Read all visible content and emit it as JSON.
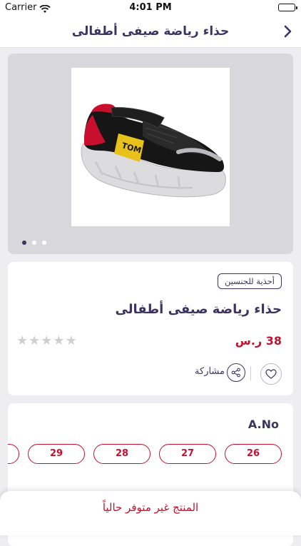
{
  "status_bar": {
    "carrier": "Carrier",
    "time": "4:01 PM"
  },
  "nav": {
    "title": "حذاء رياضة صيفى أطفالى"
  },
  "gallery": {
    "image_count": 3,
    "active_index": 0,
    "shoe_brand": "TOM"
  },
  "product": {
    "category_tag": "أحذية للجنسين",
    "name": "حذاء رياضة صيفى أطفالى",
    "price": "38 ر.س",
    "rating_stars": 5,
    "rating_value": 0,
    "share_label": "مشاركة"
  },
  "sizes": {
    "label": "A.No",
    "options": [
      "26",
      "27",
      "28",
      "29",
      ""
    ]
  },
  "footer": {
    "message": "المنتج غير متوفر حالياً"
  },
  "colors": {
    "primary": "#3a3560",
    "accent": "#c8102e"
  }
}
